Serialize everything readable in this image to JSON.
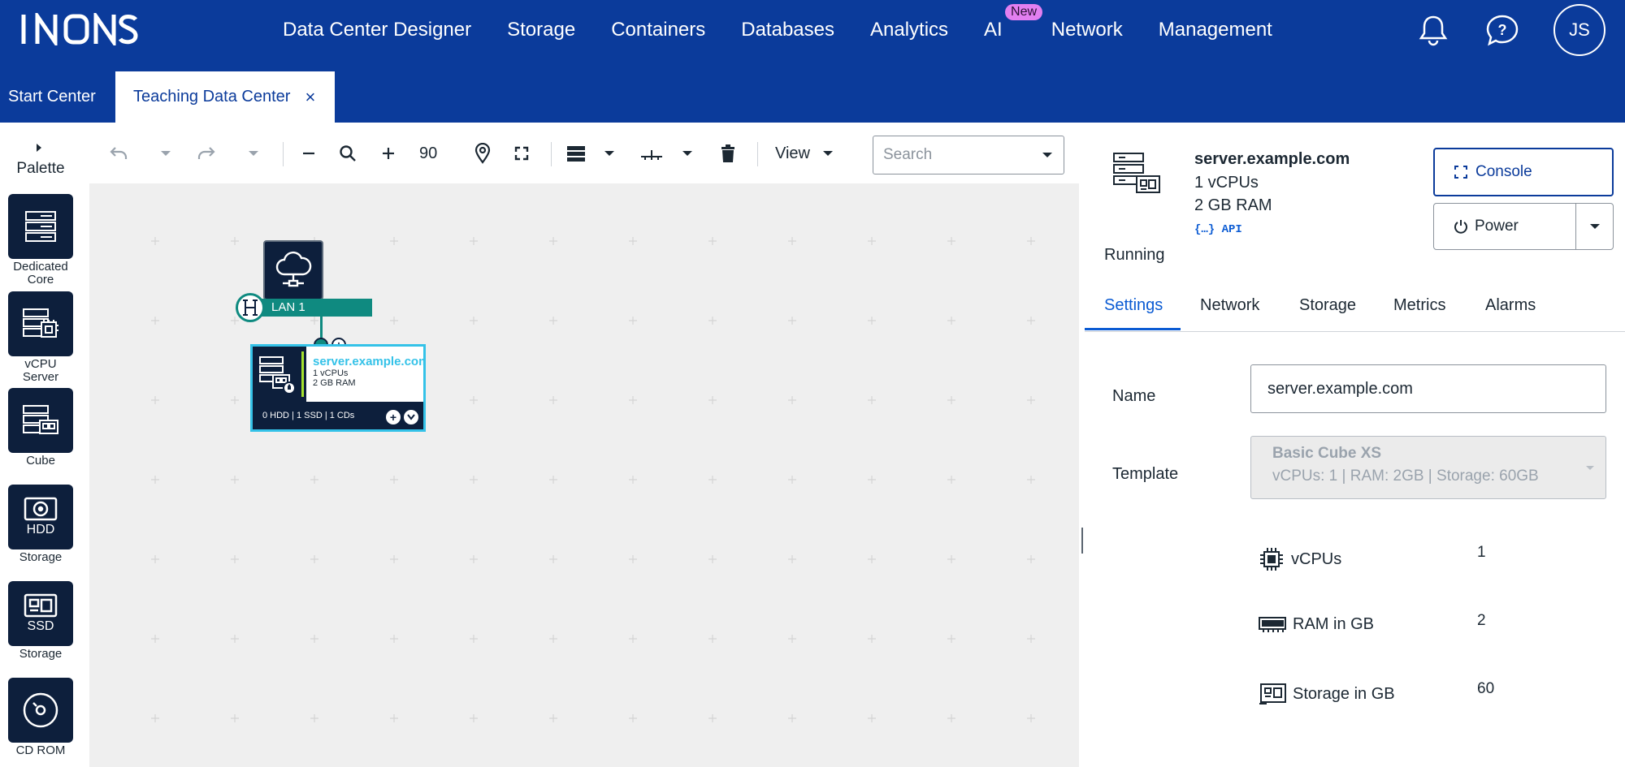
{
  "brand": {
    "logo": "IONOS"
  },
  "topnav": {
    "items": [
      {
        "label": "Data Center Designer"
      },
      {
        "label": "Storage"
      },
      {
        "label": "Containers"
      },
      {
        "label": "Databases"
      },
      {
        "label": "Analytics"
      },
      {
        "label": "AI",
        "badge": "New"
      },
      {
        "label": "Network"
      },
      {
        "label": "Management"
      }
    ],
    "avatar_initials": "JS",
    "icons": [
      "bell-icon",
      "help-icon"
    ]
  },
  "tabs": {
    "start": "Start Center",
    "active": "Teaching Data Center",
    "close": "×"
  },
  "palette": {
    "title": "Palette",
    "items": [
      {
        "label": "Dedicated Core",
        "icon": "dedicated-core-icon"
      },
      {
        "label": "vCPU Server",
        "icon": "vcpu-server-icon"
      },
      {
        "label": "Cube",
        "icon": "cube-icon"
      },
      {
        "label": "Storage",
        "inner": "HDD",
        "icon": "hdd-icon"
      },
      {
        "label": "Storage",
        "inner": "SSD",
        "icon": "ssd-icon"
      },
      {
        "label": "CD ROM",
        "icon": "cdrom-icon"
      }
    ]
  },
  "toolbar": {
    "zoom": "90",
    "view_label": "View",
    "search_placeholder": "Search"
  },
  "canvas": {
    "lan_label": "LAN 1",
    "server": {
      "name": "server.example.com",
      "cpu": "1 vCPUs",
      "ram": "2 GB RAM",
      "footer": "0 HDD | 1 SSD | 1 CDs"
    }
  },
  "panel": {
    "server_name": "server.example.com",
    "cpu": "1 vCPUs",
    "ram": "2 GB RAM",
    "api_label": "{…} API",
    "status": "Running",
    "console_label": "Console",
    "power_label": "Power",
    "tabs": [
      "Settings",
      "Network",
      "Storage",
      "Metrics",
      "Alarms"
    ],
    "fields": {
      "name_label": "Name",
      "name_value": "server.example.com",
      "template_label": "Template",
      "template_title": "Basic Cube XS",
      "template_detail": "vCPUs: 1 | RAM: 2GB | Storage: 60GB"
    },
    "resources": [
      {
        "label": "vCPUs",
        "value": "1",
        "icon": "cpu-chip-icon"
      },
      {
        "label": "RAM in GB",
        "value": "2",
        "icon": "ram-icon"
      },
      {
        "label": "Storage in GB",
        "value": "60",
        "icon": "storage-icon"
      }
    ]
  },
  "colors": {
    "nav_bg": "#0b3b9b",
    "accent": "#0b5bd3",
    "lan": "#0f8a80",
    "server_highlight": "#34c2e8",
    "palette_tile": "#0d1f3c"
  }
}
